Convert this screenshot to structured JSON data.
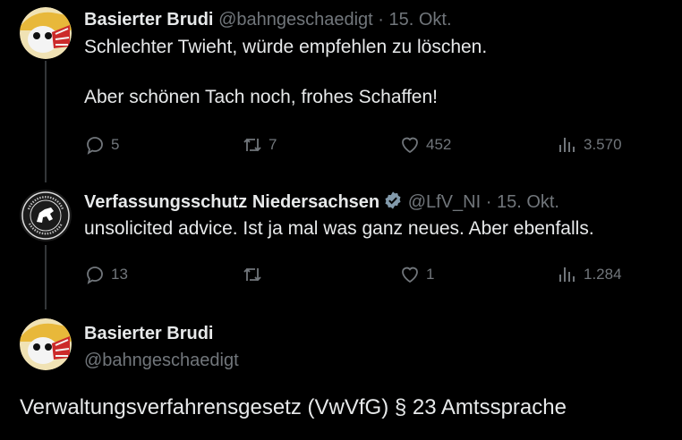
{
  "tweet1": {
    "name": "Basierter Brudi",
    "handle": "@bahngeschaedigt",
    "separator": "·",
    "date": "15. Okt.",
    "line1": "Schlechter Twieht, würde empfehlen zu löschen.",
    "line2": "Aber schönen Tach noch, frohes Schaffen!",
    "replies": "5",
    "retweets": "7",
    "likes": "452",
    "views": "3.570"
  },
  "tweet2": {
    "name": "Verfassungsschutz Niedersachsen",
    "handle": "@LfV_NI",
    "separator": "·",
    "date": "15. Okt.",
    "line1": "unsolicited advice. Ist ja mal was ganz neues. Aber ebenfalls.",
    "replies": "13",
    "retweets": "",
    "likes": "1",
    "views": "1.284"
  },
  "tweet3": {
    "name": "Basierter Brudi",
    "handle": "@bahngeschaedigt",
    "text": "Verwaltungsverfahrensgesetz (VwVfG) § 23 Amtssprache"
  },
  "icons": {
    "reply": "reply-icon",
    "retweet": "retweet-icon",
    "like": "heart-icon",
    "views": "analytics-icon",
    "verified": "verified-badge-icon"
  },
  "colors": {
    "background": "#000000",
    "text": "#e7e9ea",
    "muted": "#71767b",
    "verified": "#829aab"
  }
}
